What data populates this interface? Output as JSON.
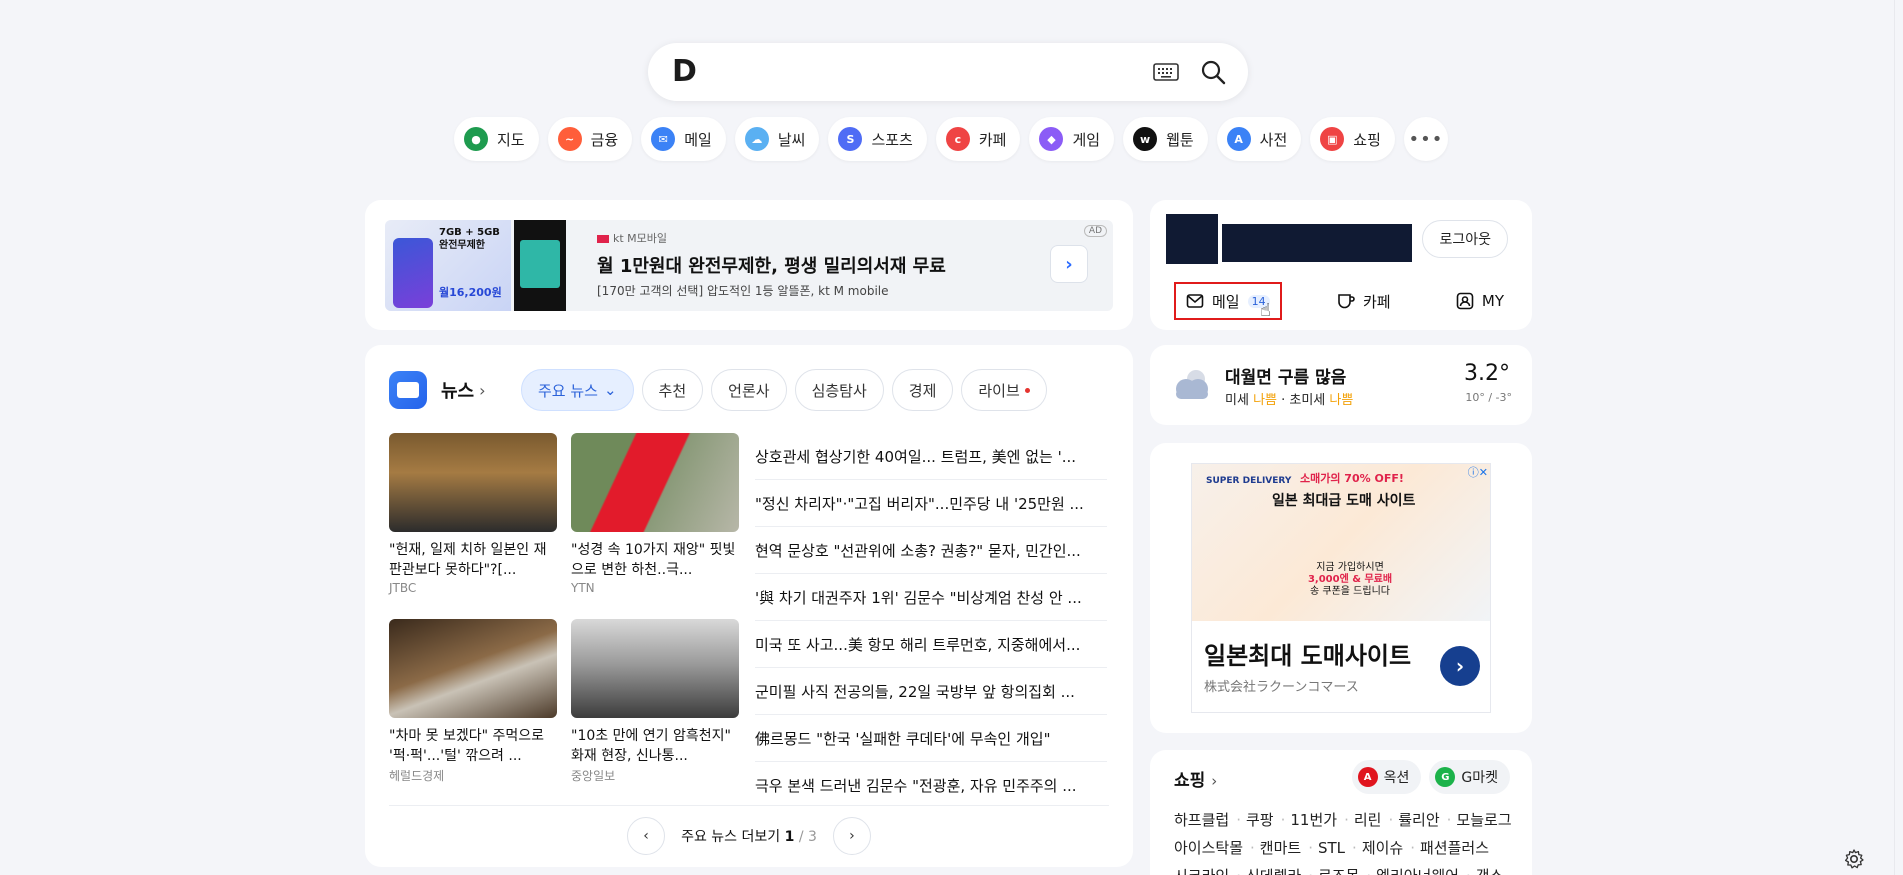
{
  "search": {
    "logo": "D",
    "placeholder": ""
  },
  "services": [
    {
      "label": "지도",
      "color": "#1e9b4f",
      "glyph": "●"
    },
    {
      "label": "금융",
      "color": "#ff5e3a",
      "glyph": "~"
    },
    {
      "label": "메일",
      "color": "#3b82f6",
      "glyph": "✉"
    },
    {
      "label": "날씨",
      "color": "#5ab0f2",
      "glyph": "☁"
    },
    {
      "label": "스포츠",
      "color": "#4f6cf5",
      "glyph": "S"
    },
    {
      "label": "카페",
      "color": "#ef4444",
      "glyph": "c"
    },
    {
      "label": "게임",
      "color": "#8b5cf6",
      "glyph": "◆"
    },
    {
      "label": "웹툰",
      "color": "#111111",
      "glyph": "w"
    },
    {
      "label": "사전",
      "color": "#3b82f6",
      "glyph": "A"
    },
    {
      "label": "쇼핑",
      "color": "#ef4444",
      "glyph": "▣"
    }
  ],
  "top_ad": {
    "brand": "kt M모바일",
    "title": "월 1만원대 완전무제한, 평생 밀리의서재 무료",
    "subtitle": "[170만 고객의 선택] 압도적인 1등 알뜰폰, kt M mobile",
    "badge": "AD",
    "img_text": "7GB + 5GB 완전무제한",
    "img_price": "월16,200원"
  },
  "news": {
    "label": "뉴스",
    "tabs": [
      {
        "label": "주요 뉴스",
        "active": true
      },
      {
        "label": "추천",
        "active": false
      },
      {
        "label": "언론사",
        "active": false
      },
      {
        "label": "심층탐사",
        "active": false
      },
      {
        "label": "경제",
        "active": false
      },
      {
        "label": "라이브",
        "active": false
      }
    ],
    "thumbs": [
      {
        "caption": "\"헌재, 일제 치하 일본인 재판관보다 못하다\"?[...",
        "source": "JTBC"
      },
      {
        "caption": "\"성경 속 10가지 재앙\" 핏빛으로 변한 하천..극...",
        "source": "YTN"
      },
      {
        "caption": "\"차마 못 보겠다\" 주먹으로 '퍽·퍽'...'털' 깎으려 ...",
        "source": "헤럴드경제"
      },
      {
        "caption": "\"10초 만에 연기 암흑천지\" 화재 현장, 신나통...",
        "source": "중앙일보"
      }
    ],
    "headlines": [
      "상호관세 협상기한 40여일... 트럼프, 美엔 없는 '...",
      "\"정신 차리자\"·\"고집 버리자\"...민주당 내 '25만원 ...",
      "현역 문상호 \"선관위에 소총? 권총?\" 묻자, 민간인...",
      "'與 차기 대권주자 1위' 김문수 \"비상계엄 찬성 안 ...",
      "미국 또 사고...美 항모 해리 트루먼호, 지중해에서...",
      "군미필 사직 전공의들, 22일 국방부 앞 항의집회 ...",
      "佛르몽드 \"한국 '실패한 쿠데타'에 무속인 개입\"",
      "극우 본색 드러낸 김문수 \"전광훈, 자유 민주주의 ..."
    ],
    "pager": {
      "label": "주요 뉴스 더보기",
      "current": "1",
      "total": "/ 3"
    }
  },
  "user": {
    "logout": "로그아웃",
    "links": [
      {
        "label": "메일",
        "count": "14"
      },
      {
        "label": "카페",
        "count": ""
      },
      {
        "label": "MY",
        "count": ""
      }
    ]
  },
  "weather": {
    "title": "대월면 구름 많음",
    "dust_label1": "미세",
    "dust_value1": "나쁨",
    "dust_label2": "초미세",
    "dust_value2": "나쁨",
    "temp": "3.2°",
    "range": "10° / -3°"
  },
  "right_ad": {
    "brand": "SUPER DELIVERY",
    "sale": "소매가의 70% OFF!",
    "headline": "일본 최대급 도매 사이트",
    "bubble_line1": "지금 가입하시면",
    "bubble_line2": "3,000엔 & 무료배",
    "bubble_line3": "송 쿠폰을 드립니다",
    "title": "일본최대 도매사이트",
    "subtitle": "株式会社ラクーンコマース"
  },
  "shopping": {
    "title": "쇼핑",
    "btn1": "옥션",
    "btn2": "G마켓",
    "row1": [
      "하프클럽",
      "쿠팡",
      "11번가",
      "리린",
      "률리안",
      "모늘로그"
    ],
    "row2": [
      "아이스탁몰",
      "캔마트",
      "STL",
      "제이슈",
      "패션플러스"
    ],
    "row3": [
      "시크라인",
      "신데렐라",
      "로즈몽",
      "엘리아너웨어",
      "갱소"
    ]
  }
}
